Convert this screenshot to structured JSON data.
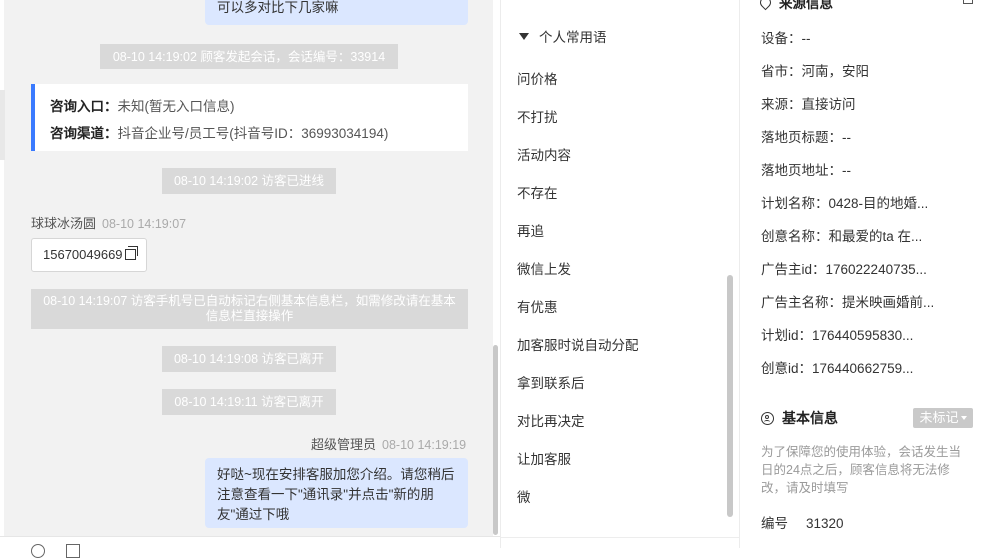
{
  "chat": {
    "prev_bubble_text": "可以多对比下几家嘛",
    "sys_start": "08-10 14:19:02 顾客发起会话，会话编号：33914",
    "info_card": {
      "entry_label": "咨询入口：",
      "entry_value": "未知(暂无入口信息)",
      "channel_label": "咨询渠道：",
      "channel_value": "抖音企业号/员工号(抖音号ID：36993034194)"
    },
    "sys_enter": "08-10 14:19:02 访客已进线",
    "visitor_name": "球球冰汤圆",
    "visitor_time": "08-10 14:19:07",
    "visitor_phone": "15670049669",
    "sys_phone_marked": "08-10 14:19:07 访客手机号已自动标记右侧基本信息栏，如需修改请在基本信息栏直接操作",
    "sys_leave_1": "08-10 14:19:08 访客已离开",
    "sys_leave_2": "08-10 14:19:11 访客已离开",
    "agent_name": "超级管理员",
    "agent_time": "08-10 14:19:19",
    "agent_message": "好哒~现在安排客服加您介绍。请您稍后注意查看一下\"通讯录\"并点击\"新的朋友\"通过下哦"
  },
  "phrases": {
    "group_title": "个人常用语",
    "items": [
      "问价格",
      "不打扰",
      "活动内容",
      "不存在",
      "再追",
      "微信上发",
      "有优惠",
      "加客服时说自动分配",
      "拿到联系后",
      "对比再决定",
      "让加客服",
      "微"
    ]
  },
  "info": {
    "source_title": "来源信息",
    "rows": [
      "设备：--",
      "省市：河南，安阳",
      "来源：直接访问",
      "落地页标题：--",
      "落地页地址：--",
      "计划名称：0428-目的地婚...",
      "创意名称：和最爱的ta 在...",
      "广告主id：176022240735...",
      "广告主名称：提米映画婚前...",
      "计划id：176440595830...",
      "创意id：176440662759..."
    ],
    "basic_title": "基本信息",
    "tag_label": "未标记",
    "hint": "为了保障您的使用体验，会话发生当日的24点之后，顾客信息将无法修改，请及时填写",
    "number_label": "编号",
    "number_value": "31320"
  },
  "icons": [
    "triangle-down-icon",
    "copy-icon",
    "person-icon",
    "caret-down-icon",
    "edit-icon",
    "location-icon",
    "emoji-icon",
    "image-icon"
  ],
  "colors": {
    "accent": "#3a7afe",
    "bubble": "#dbe7ff",
    "system": "#d9d9d9",
    "chat_bg": "#f2f2f2"
  }
}
